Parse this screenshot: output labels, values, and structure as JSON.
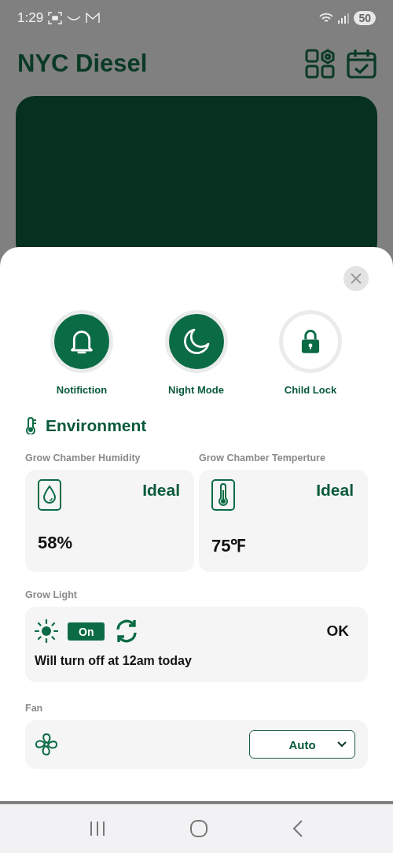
{
  "status_bar": {
    "time": "1:29",
    "battery": "50"
  },
  "header": {
    "title": "NYC Diesel"
  },
  "sheet": {
    "toggles": [
      {
        "label": "Notifiction",
        "kind": "bell",
        "on": true
      },
      {
        "label": "Night Mode",
        "kind": "moon",
        "on": true
      },
      {
        "label": "Child Lock",
        "kind": "lock",
        "on": false
      }
    ],
    "section": {
      "title": "Environment"
    },
    "sensors": [
      {
        "label": "Grow Chamber Humidity",
        "kind": "humidity",
        "status": "Ideal",
        "value": "58%"
      },
      {
        "label": "Grow Chamber Temperture",
        "kind": "temperature",
        "status": "Ideal",
        "value": "75℉"
      }
    ],
    "grow_light": {
      "label": "Grow Light",
      "switch": "On",
      "on": true,
      "status": "OK",
      "note": "Will turn off at 12am today"
    },
    "fan": {
      "label": "Fan",
      "mode": "Auto"
    }
  }
}
